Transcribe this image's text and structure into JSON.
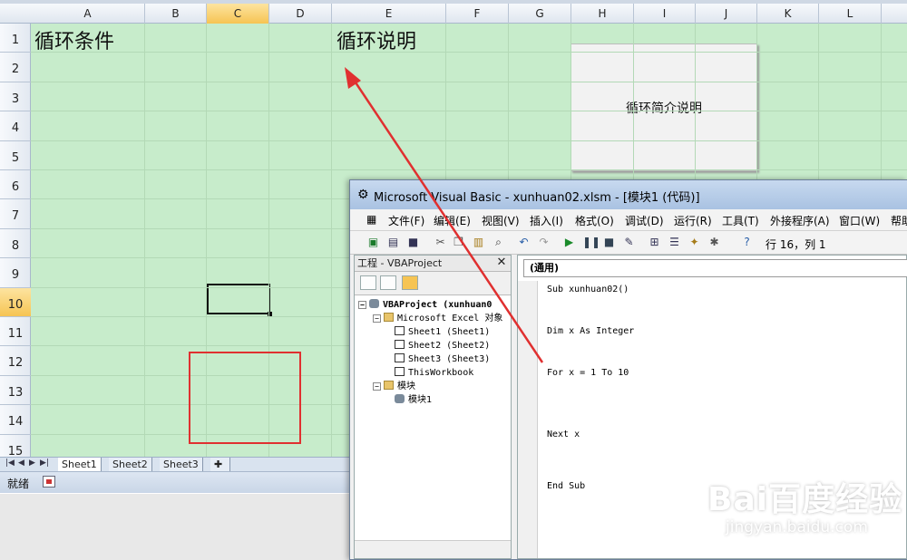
{
  "excel": {
    "columns": [
      "A",
      "B",
      "C",
      "D",
      "E",
      "F",
      "G",
      "H",
      "I",
      "J",
      "K",
      "L"
    ],
    "selected_column": "C",
    "rows": [
      "1",
      "2",
      "3",
      "4",
      "5",
      "6",
      "7",
      "8",
      "9",
      "10",
      "11",
      "12",
      "13",
      "14",
      "15"
    ],
    "selected_row": "10",
    "cells": {
      "a1": "循环条件",
      "e1": "循环说明"
    },
    "shape_text": "循环简介说明",
    "sheet_tabs": [
      "Sheet1",
      "Sheet2",
      "Sheet3"
    ],
    "status_text": "就绪"
  },
  "vba": {
    "title": "Microsoft Visual Basic - xunhuan02.xlsm - [模块1 (代码)]",
    "menu": [
      "文件(F)",
      "编辑(E)",
      "视图(V)",
      "插入(I)",
      "格式(O)",
      "调试(D)",
      "运行(R)",
      "工具(T)",
      "外接程序(A)",
      "窗口(W)",
      "帮助"
    ],
    "position": "行 16，列 1",
    "project_title": "工程 - VBAProject",
    "tree": {
      "root": "VBAProject (xunhuan0",
      "excel_objects": "Microsoft Excel 对象",
      "sheets": [
        "Sheet1 (Sheet1)",
        "Sheet2 (Sheet2)",
        "Sheet3 (Sheet3)"
      ],
      "workbook": "ThisWorkbook",
      "modules_folder": "模块",
      "module": "模块1"
    },
    "code_scope": "(通用)",
    "code": {
      "line1": "Sub xunhuan02()",
      "line2": "Dim x As Integer",
      "line3": "For x = 1 To 10",
      "line4": "Next x",
      "line5": "End Sub"
    }
  },
  "annotation": {
    "arrow_color": "#e03030",
    "box_color": "#e03030"
  },
  "watermark": {
    "logo": "Bai百度经验",
    "url": "jingyan.baidu.com"
  }
}
